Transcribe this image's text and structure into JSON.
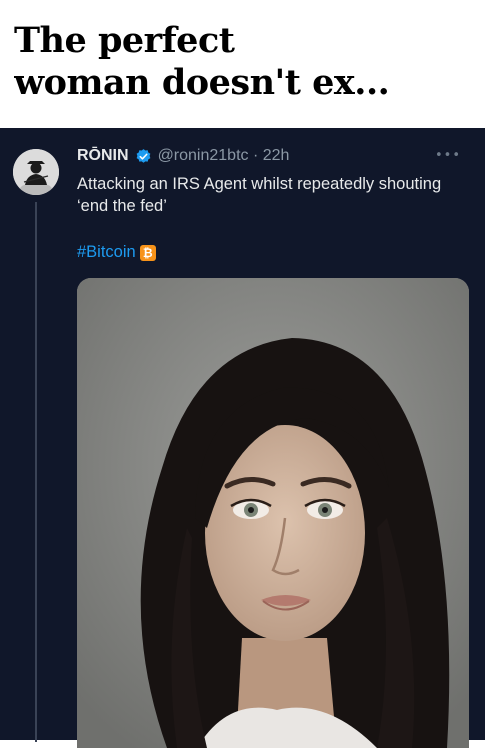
{
  "caption": {
    "line1": "The perfect",
    "line2": "woman doesn't ex..."
  },
  "tweet": {
    "display_name": "RŌNIN",
    "handle_time": "@ronin21btc · 22h",
    "more_icon": "more-dots-icon",
    "text": "Attacking an IRS Agent whilst repeatedly shouting ‘end the fed’",
    "hashtag": "#Bitcoin",
    "hashtag_icon": "bitcoin-icon",
    "verified_icon": "verified-badge-icon"
  },
  "colors": {
    "tweet_bg": "#10172a",
    "name": "#e7e9ea",
    "handle": "#8b98a5",
    "link": "#1d9bf0",
    "verified": "#1d9bf0",
    "bitcoin": "#f7931a"
  }
}
